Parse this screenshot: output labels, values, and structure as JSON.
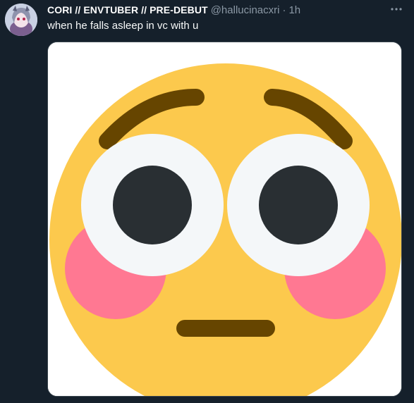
{
  "tweet": {
    "display_name": "CORI // ENVTUBER // PRE-DEBUT",
    "handle": "@hallucinacxri",
    "separator": "·",
    "time": "1h",
    "text": "when he falls asleep in vc with u",
    "more_icon": "more-horizontal-icon",
    "media_icon": "flushed-face-emoji"
  },
  "colors": {
    "background": "#15202b",
    "text": "#f7f9f9",
    "secondary_text": "#8b98a5",
    "emoji_face": "#fcc94d",
    "emoji_features": "#664500",
    "emoji_eye_white": "#f4f7f9",
    "emoji_pupil": "#292f33",
    "emoji_blush": "#ff7892"
  }
}
